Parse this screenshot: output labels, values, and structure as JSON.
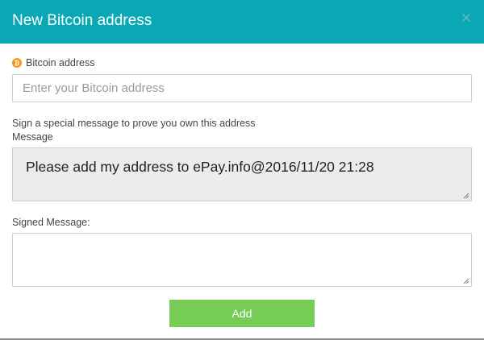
{
  "header": {
    "title": "New Bitcoin address",
    "close_icon": "close-icon",
    "background_color": "#0aa7b4"
  },
  "bitcoin_address": {
    "label": "Bitcoin address",
    "icon": "bitcoin-icon",
    "icon_color": "#f7931a",
    "value": "",
    "placeholder": "Enter your Bitcoin address"
  },
  "sign": {
    "hint": "Sign a special message to prove you own this address",
    "message_label": "Message",
    "message_text": "Please add my address to ePay.info@2016/11/20 21:28",
    "signed_label": "Signed Message:",
    "signed_value": ""
  },
  "actions": {
    "add_label": "Add",
    "add_color": "#77cc55"
  }
}
